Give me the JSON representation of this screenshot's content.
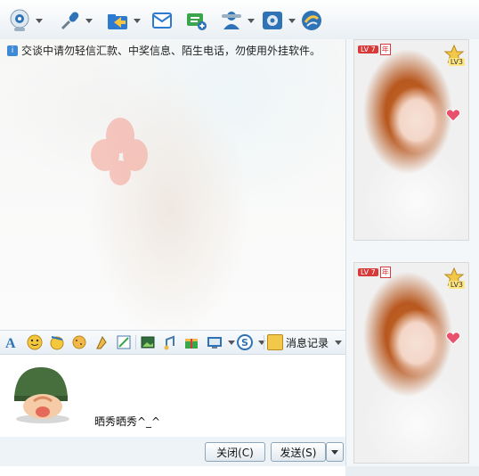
{
  "toolbar": {
    "items": [
      {
        "name": "video-icon",
        "dropdown": true
      },
      {
        "name": "audio-icon",
        "dropdown": true
      },
      {
        "name": "file-transfer-icon",
        "dropdown": true
      },
      {
        "name": "mail-icon",
        "dropdown": false
      },
      {
        "name": "create-group-icon",
        "dropdown": false
      },
      {
        "name": "remote-assist-icon",
        "dropdown": true
      },
      {
        "name": "app-settings-icon",
        "dropdown": true
      },
      {
        "name": "app-center-icon",
        "dropdown": false
      }
    ]
  },
  "chat": {
    "notice": "交谈中请勿轻信汇款、中奖信息、陌生电话，勿使用外挂软件。"
  },
  "input_toolbar": {
    "msg_log_label": "消息记录"
  },
  "input": {
    "text": "晒秀晒秀^_^"
  },
  "bottom": {
    "close_label": "关闭(C)",
    "send_label": "发送(S)"
  },
  "right_panel": {
    "cards": [
      {
        "level": "LV 7",
        "year": "年",
        "vip": "LV3"
      },
      {
        "level": "LV 7",
        "year": "年",
        "vip": "LV3"
      }
    ]
  },
  "colors": {
    "accent": "#3e8ad4",
    "badge_red": "#d83a3a",
    "star_gold": "#f2c84b"
  }
}
